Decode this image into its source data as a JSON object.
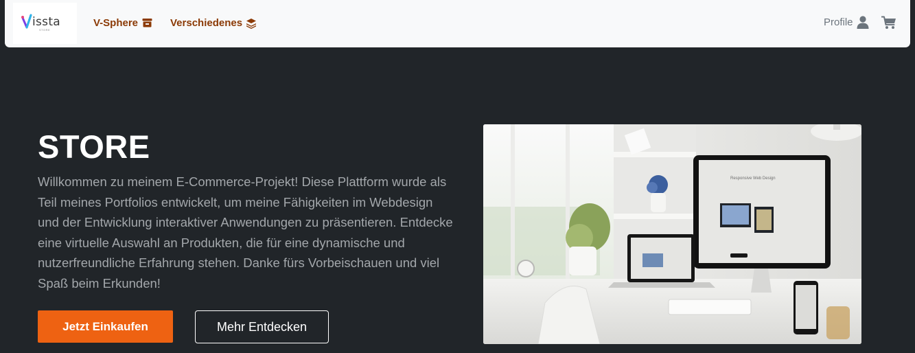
{
  "brand": {
    "name": "issta",
    "subtitle": "STORE",
    "accent_colors": [
      "#7b3fe4",
      "#e8457a",
      "#2db7e8"
    ]
  },
  "nav": {
    "links": [
      {
        "label": "V-Sphere",
        "icon": "store-icon"
      },
      {
        "label": "Verschiedenes",
        "icon": "layers-icon"
      }
    ],
    "profile_label": "Profile",
    "profile_icon": "user-icon",
    "cart_icon": "cart-icon",
    "link_color": "#8b3a06"
  },
  "hero": {
    "title": "STORE",
    "description": "Willkommen zu meinem E-Commerce-Projekt! Diese Plattform wurde als Teil meines Portfolios entwickelt, um meine Fähigkeiten im Webdesign und der Entwicklung interaktiver Anwendungen zu präsentieren. Entdecke eine virtuelle Auswahl an Produkten, die für eine dynamische und nutzerfreundliche Erfahrung stehen. Danke fürs Vorbeischauen und viel Spaß beim Erkunden!",
    "primary_button": "Jetzt Einkaufen",
    "secondary_button": "Mehr Entdecken",
    "primary_color": "#ee6212",
    "background_color": "#212529",
    "image": {
      "monitor_heading": "Responsive Web Design"
    }
  }
}
